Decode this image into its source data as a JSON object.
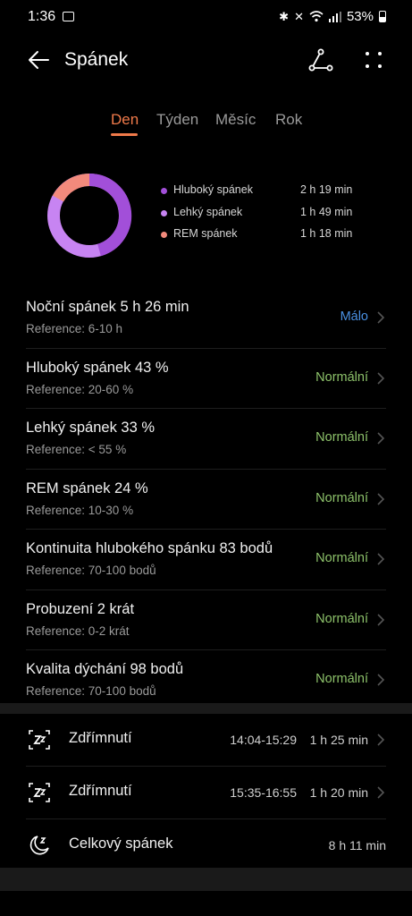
{
  "status_bar": {
    "time": "1:36",
    "battery": "53%"
  },
  "header": {
    "title": "Spánek"
  },
  "tabs": [
    {
      "label": "Den",
      "active": true
    },
    {
      "label": "Týden",
      "active": false
    },
    {
      "label": "Měsíc",
      "active": false
    },
    {
      "label": "Rok",
      "active": false
    }
  ],
  "summary": {
    "legend": [
      {
        "name": "Hluboký spánek",
        "value": "2 h 19 min",
        "color": "#a24fd9"
      },
      {
        "name": "Lehký spánek",
        "value": "1 h 49 min",
        "color": "#c784f2"
      },
      {
        "name": "REM spánek",
        "value": "1 h 18 min",
        "color": "#f28a7c"
      }
    ]
  },
  "metrics": [
    {
      "title": "Noční spánek  5 h 26 min",
      "reference": "Reference: 6-10 h",
      "status": "Málo",
      "status_color": "#4a90e2"
    },
    {
      "title": "Hluboký spánek  43 %",
      "reference": "Reference: 20-60 %",
      "status": "Normální",
      "status_color": "#8dc26a"
    },
    {
      "title": "Lehký spánek  33 %",
      "reference": "Reference: < 55 %",
      "status": "Normální",
      "status_color": "#8dc26a"
    },
    {
      "title": "REM spánek  24 %",
      "reference": "Reference: 10-30 %",
      "status": "Normální",
      "status_color": "#8dc26a"
    },
    {
      "title": "Kontinuita hlubokého spánku  83 bodů",
      "reference": "Reference: 70-100 bodů",
      "status": "Normální",
      "status_color": "#8dc26a"
    },
    {
      "title": "Probuzení  2 krát",
      "reference": "Reference: 0-2 krát",
      "status": "Normální",
      "status_color": "#8dc26a"
    },
    {
      "title": "Kvalita dýchání  98 bodů",
      "reference": "Reference: 70-100 bodů",
      "status": "Normální",
      "status_color": "#8dc26a"
    }
  ],
  "sessions": [
    {
      "icon": "nap-icon",
      "label": "Zdřímnutí",
      "time": "14:04-15:29",
      "duration": "1 h 25 min"
    },
    {
      "icon": "nap-icon",
      "label": "Zdřímnutí",
      "time": "15:35-16:55",
      "duration": "1 h 20 min"
    },
    {
      "icon": "moon-icon",
      "label": "Celkový spánek",
      "time": "",
      "duration": "8 h 11 min"
    }
  ]
}
